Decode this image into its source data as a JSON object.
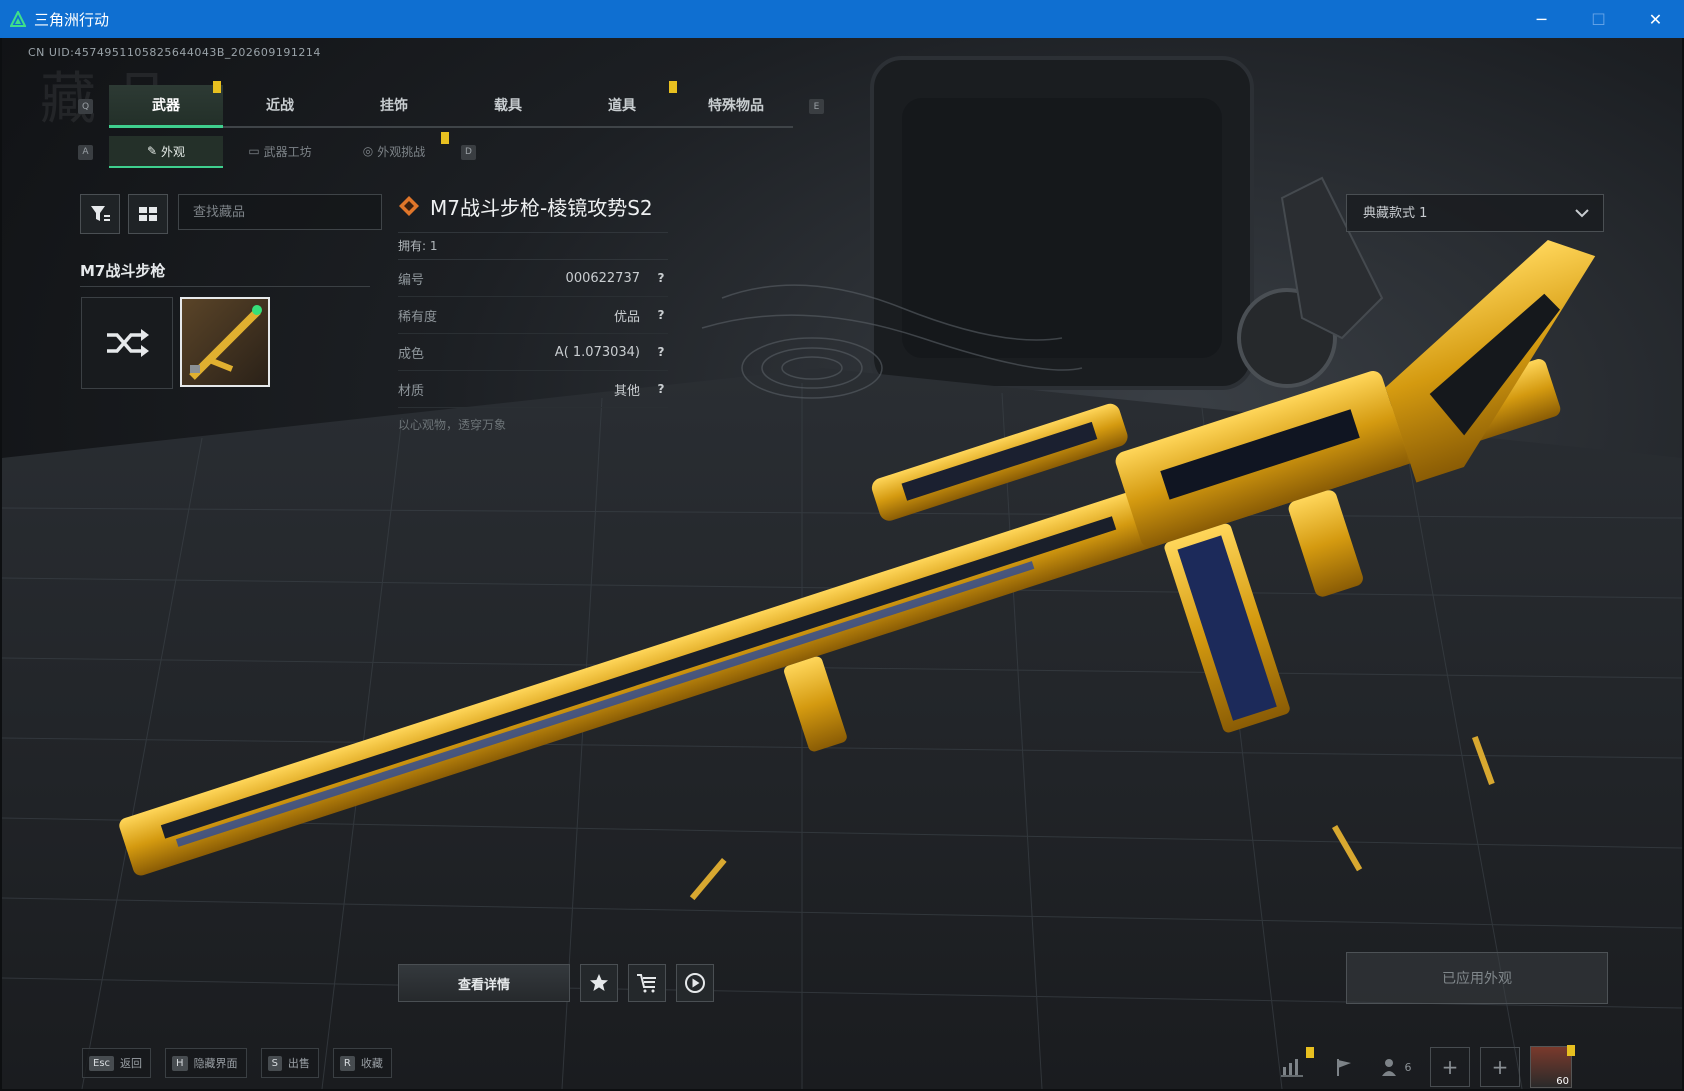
{
  "window": {
    "title": "三角洲行动",
    "minimize": "─",
    "maximize": "☐",
    "close": "✕"
  },
  "uid_text": "CN UID:4574951105825644043B_202609191214",
  "watermark": "藏 品",
  "tabs": {
    "prev_key": "Q",
    "next_key": "E",
    "items": [
      {
        "label": "武器"
      },
      {
        "label": "近战"
      },
      {
        "label": "挂饰"
      },
      {
        "label": "载具"
      },
      {
        "label": "道具"
      },
      {
        "label": "特殊物品"
      }
    ]
  },
  "subtabs": {
    "prev_key": "A",
    "next_key": "D",
    "items": [
      {
        "label": "外观"
      },
      {
        "label": "武器工坊"
      },
      {
        "label": "外观挑战"
      }
    ]
  },
  "search": {
    "placeholder": "查找藏品"
  },
  "group": {
    "title": "M7战斗步枪"
  },
  "item": {
    "title": "M7战斗步枪-棱镜攻势S2",
    "owned": "拥有: 1",
    "rows": [
      {
        "key": "编号",
        "value": "000622737"
      },
      {
        "key": "稀有度",
        "value": "优品"
      },
      {
        "key": "成色",
        "value": "A( 1.073034)"
      },
      {
        "key": "材质",
        "value": "其他"
      }
    ],
    "flavor": "以心观物，透穿万象",
    "help_mark": "?"
  },
  "style_select": {
    "value": "典藏款式 1"
  },
  "actions": {
    "details": "查看详情",
    "apply": "已应用外观"
  },
  "hotkeys": [
    {
      "key": "Esc",
      "label": "返回"
    },
    {
      "key": "H",
      "label": "隐藏界面"
    },
    {
      "key": "S",
      "label": "出售"
    },
    {
      "key": "R",
      "label": "收藏"
    }
  ],
  "tray": {
    "friends_count": "6",
    "plus": "+",
    "level": "60"
  },
  "colors": {
    "titlebar": "#0f6fd1",
    "accent_green": "#3fcf8e",
    "gold": "#e8b020",
    "badge_yellow": "#e8c020"
  }
}
